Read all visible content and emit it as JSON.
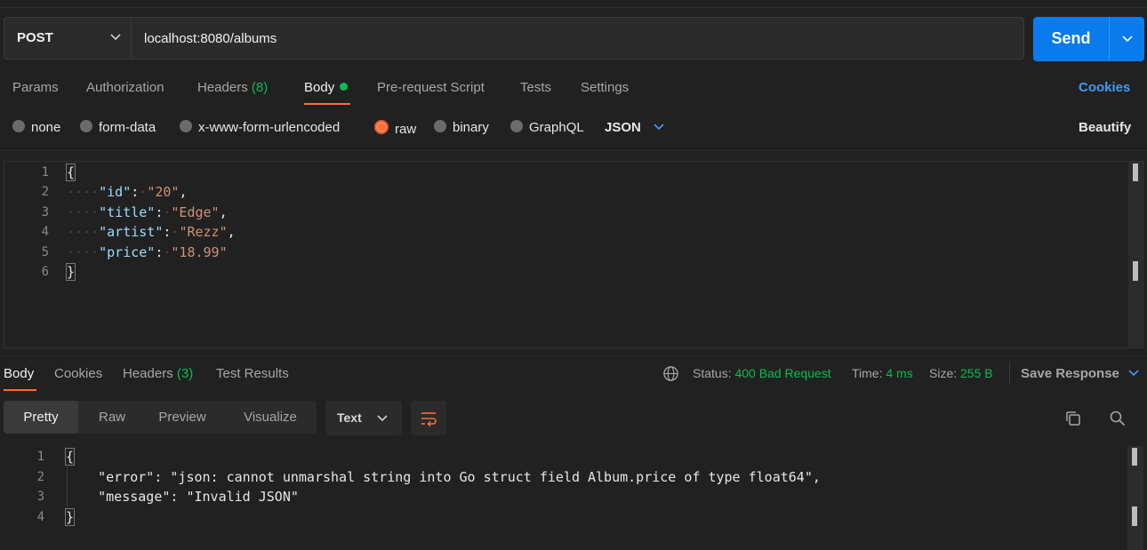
{
  "request": {
    "method": "POST",
    "url": "localhost:8080/albums",
    "send_label": "Send"
  },
  "request_tabs": {
    "params": "Params",
    "authorization": "Authorization",
    "headers": "Headers",
    "headers_count": "(8)",
    "body": "Body",
    "pre_request": "Pre-request Script",
    "tests": "Tests",
    "settings": "Settings",
    "cookies": "Cookies"
  },
  "body_types": {
    "none": "none",
    "form_data": "form-data",
    "urlencoded": "x-www-form-urlencoded",
    "raw": "raw",
    "binary": "binary",
    "graphql": "GraphQL",
    "selected": "raw",
    "language": "JSON",
    "beautify": "Beautify"
  },
  "request_body": {
    "line_numbers": [
      "1",
      "2",
      "3",
      "4",
      "5",
      "6"
    ],
    "open_brace": "{",
    "close_brace": "}",
    "fields": [
      {
        "key": "\"id\"",
        "value": "\"20\"",
        "trail": ","
      },
      {
        "key": "\"title\"",
        "value": "\"Edge\"",
        "trail": ","
      },
      {
        "key": "\"artist\"",
        "value": "\"Rezz\"",
        "trail": ","
      },
      {
        "key": "\"price\"",
        "value": "\"18.99\"",
        "trail": ""
      }
    ]
  },
  "response_tabs": {
    "body": "Body",
    "cookies": "Cookies",
    "headers": "Headers",
    "headers_count": "(3)",
    "test_results": "Test Results"
  },
  "response_status": {
    "status_label": "Status:",
    "status_value": "400 Bad Request",
    "time_label": "Time:",
    "time_value": "4 ms",
    "size_label": "Size:",
    "size_value": "255 B",
    "save_response": "Save Response"
  },
  "view_modes": {
    "pretty": "Pretty",
    "raw": "Raw",
    "preview": "Preview",
    "visualize": "Visualize",
    "selected": "Pretty",
    "format": "Text"
  },
  "response_body": {
    "line_numbers": [
      "1",
      "2",
      "3",
      "4"
    ],
    "open_brace": "{",
    "close_brace": "}",
    "line2": "    \"error\": \"json: cannot unmarshal string into Go struct field Album.price of type float64\",",
    "line3": "    \"message\": \"Invalid JSON\""
  },
  "colors": {
    "accent_blue": "#097bed",
    "tab_accent_orange": "#ff6c37",
    "status_green": "#0cbb52",
    "link_blue": "#3e9cf7",
    "json_key": "#9cdcfe",
    "json_string": "#ce9178"
  },
  "icons": {
    "method_dropdown": "chevron-down-icon",
    "send_dropdown": "chevron-down-icon",
    "language_dropdown": "chevron-down-icon",
    "network": "globe-icon",
    "save_dropdown": "chevron-down-icon",
    "wrap": "wrap-lines-icon",
    "copy": "copy-icon",
    "search": "search-icon"
  }
}
